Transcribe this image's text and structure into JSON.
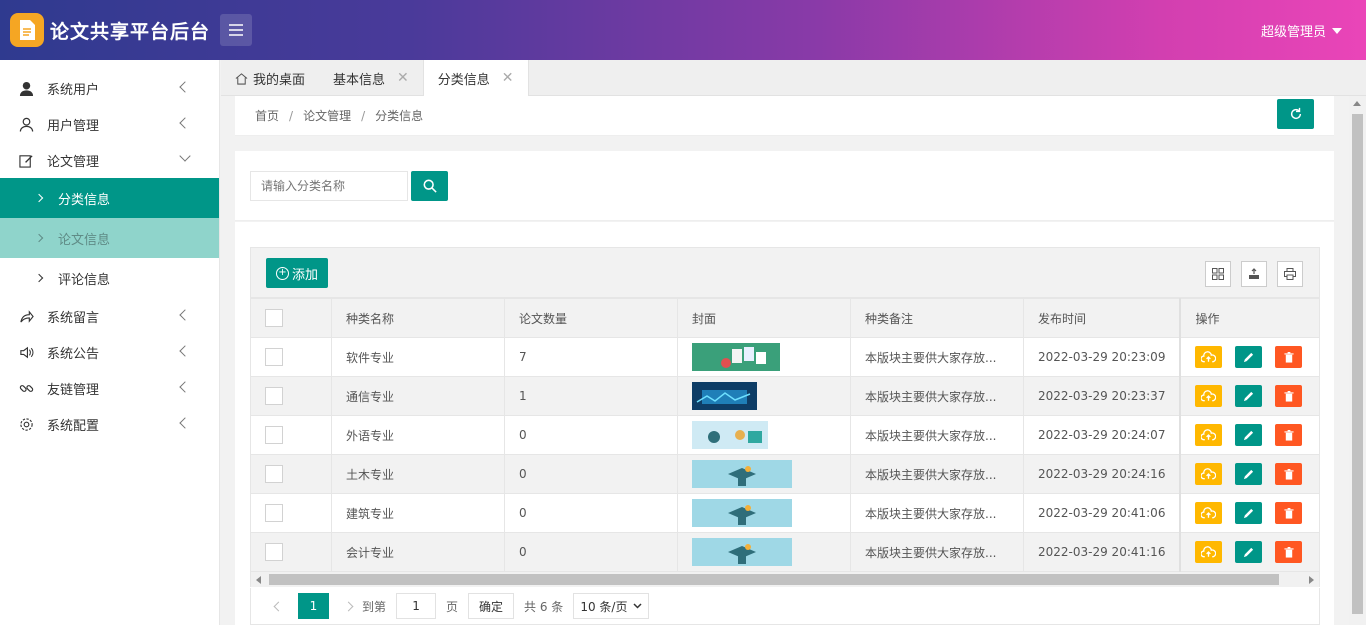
{
  "app": {
    "title": "论文共享平台后台"
  },
  "header": {
    "user_label": "超级管理员"
  },
  "sidebar": {
    "items": [
      {
        "label": "系统用户",
        "icon": "user-solid-icon"
      },
      {
        "label": "用户管理",
        "icon": "user-outline-icon"
      },
      {
        "label": "论文管理",
        "icon": "edit-icon",
        "expanded": true,
        "children": [
          {
            "label": "分类信息",
            "state": "active"
          },
          {
            "label": "论文信息",
            "state": "hover"
          },
          {
            "label": "评论信息",
            "state": "normal"
          }
        ]
      },
      {
        "label": "系统留言",
        "icon": "share-icon"
      },
      {
        "label": "系统公告",
        "icon": "speaker-icon"
      },
      {
        "label": "友链管理",
        "icon": "link-icon"
      },
      {
        "label": "系统配置",
        "icon": "gear-icon"
      }
    ]
  },
  "tabs": [
    {
      "label": "我的桌面",
      "icon": "home-icon"
    },
    {
      "label": "基本信息",
      "closable": true
    },
    {
      "label": "分类信息",
      "closable": true,
      "active": true
    }
  ],
  "breadcrumb": {
    "items": [
      "首页",
      "论文管理",
      "分类信息"
    ],
    "separator": "/"
  },
  "search": {
    "placeholder": "请输入分类名称"
  },
  "toolbar": {
    "add_label": "添加"
  },
  "table": {
    "columns": [
      "种类名称",
      "论文数量",
      "封面",
      "种类备注",
      "发布时间",
      "操作"
    ],
    "rows": [
      {
        "name": "软件专业",
        "count": "7",
        "remark": "本版块主要供大家存放...",
        "time": "2022-03-29 20:23:09"
      },
      {
        "name": "通信专业",
        "count": "1",
        "remark": "本版块主要供大家存放...",
        "time": "2022-03-29 20:23:37"
      },
      {
        "name": "外语专业",
        "count": "0",
        "remark": "本版块主要供大家存放...",
        "time": "2022-03-29 20:24:07"
      },
      {
        "name": "土木专业",
        "count": "0",
        "remark": "本版块主要供大家存放...",
        "time": "2022-03-29 20:24:16"
      },
      {
        "name": "建筑专业",
        "count": "0",
        "remark": "本版块主要供大家存放...",
        "time": "2022-03-29 20:41:06"
      },
      {
        "name": "会计专业",
        "count": "0",
        "remark": "本版块主要供大家存放...",
        "time": "2022-03-29 20:41:16"
      }
    ]
  },
  "pager": {
    "current": "1",
    "goto_label": "到第",
    "goto_value": "1",
    "page_unit": "页",
    "confirm_label": "确定",
    "total_label": "共 6 条",
    "page_size": "10 条/页"
  },
  "colors": {
    "primary": "#009688",
    "warn": "#ffb800",
    "danger": "#ff5722"
  }
}
